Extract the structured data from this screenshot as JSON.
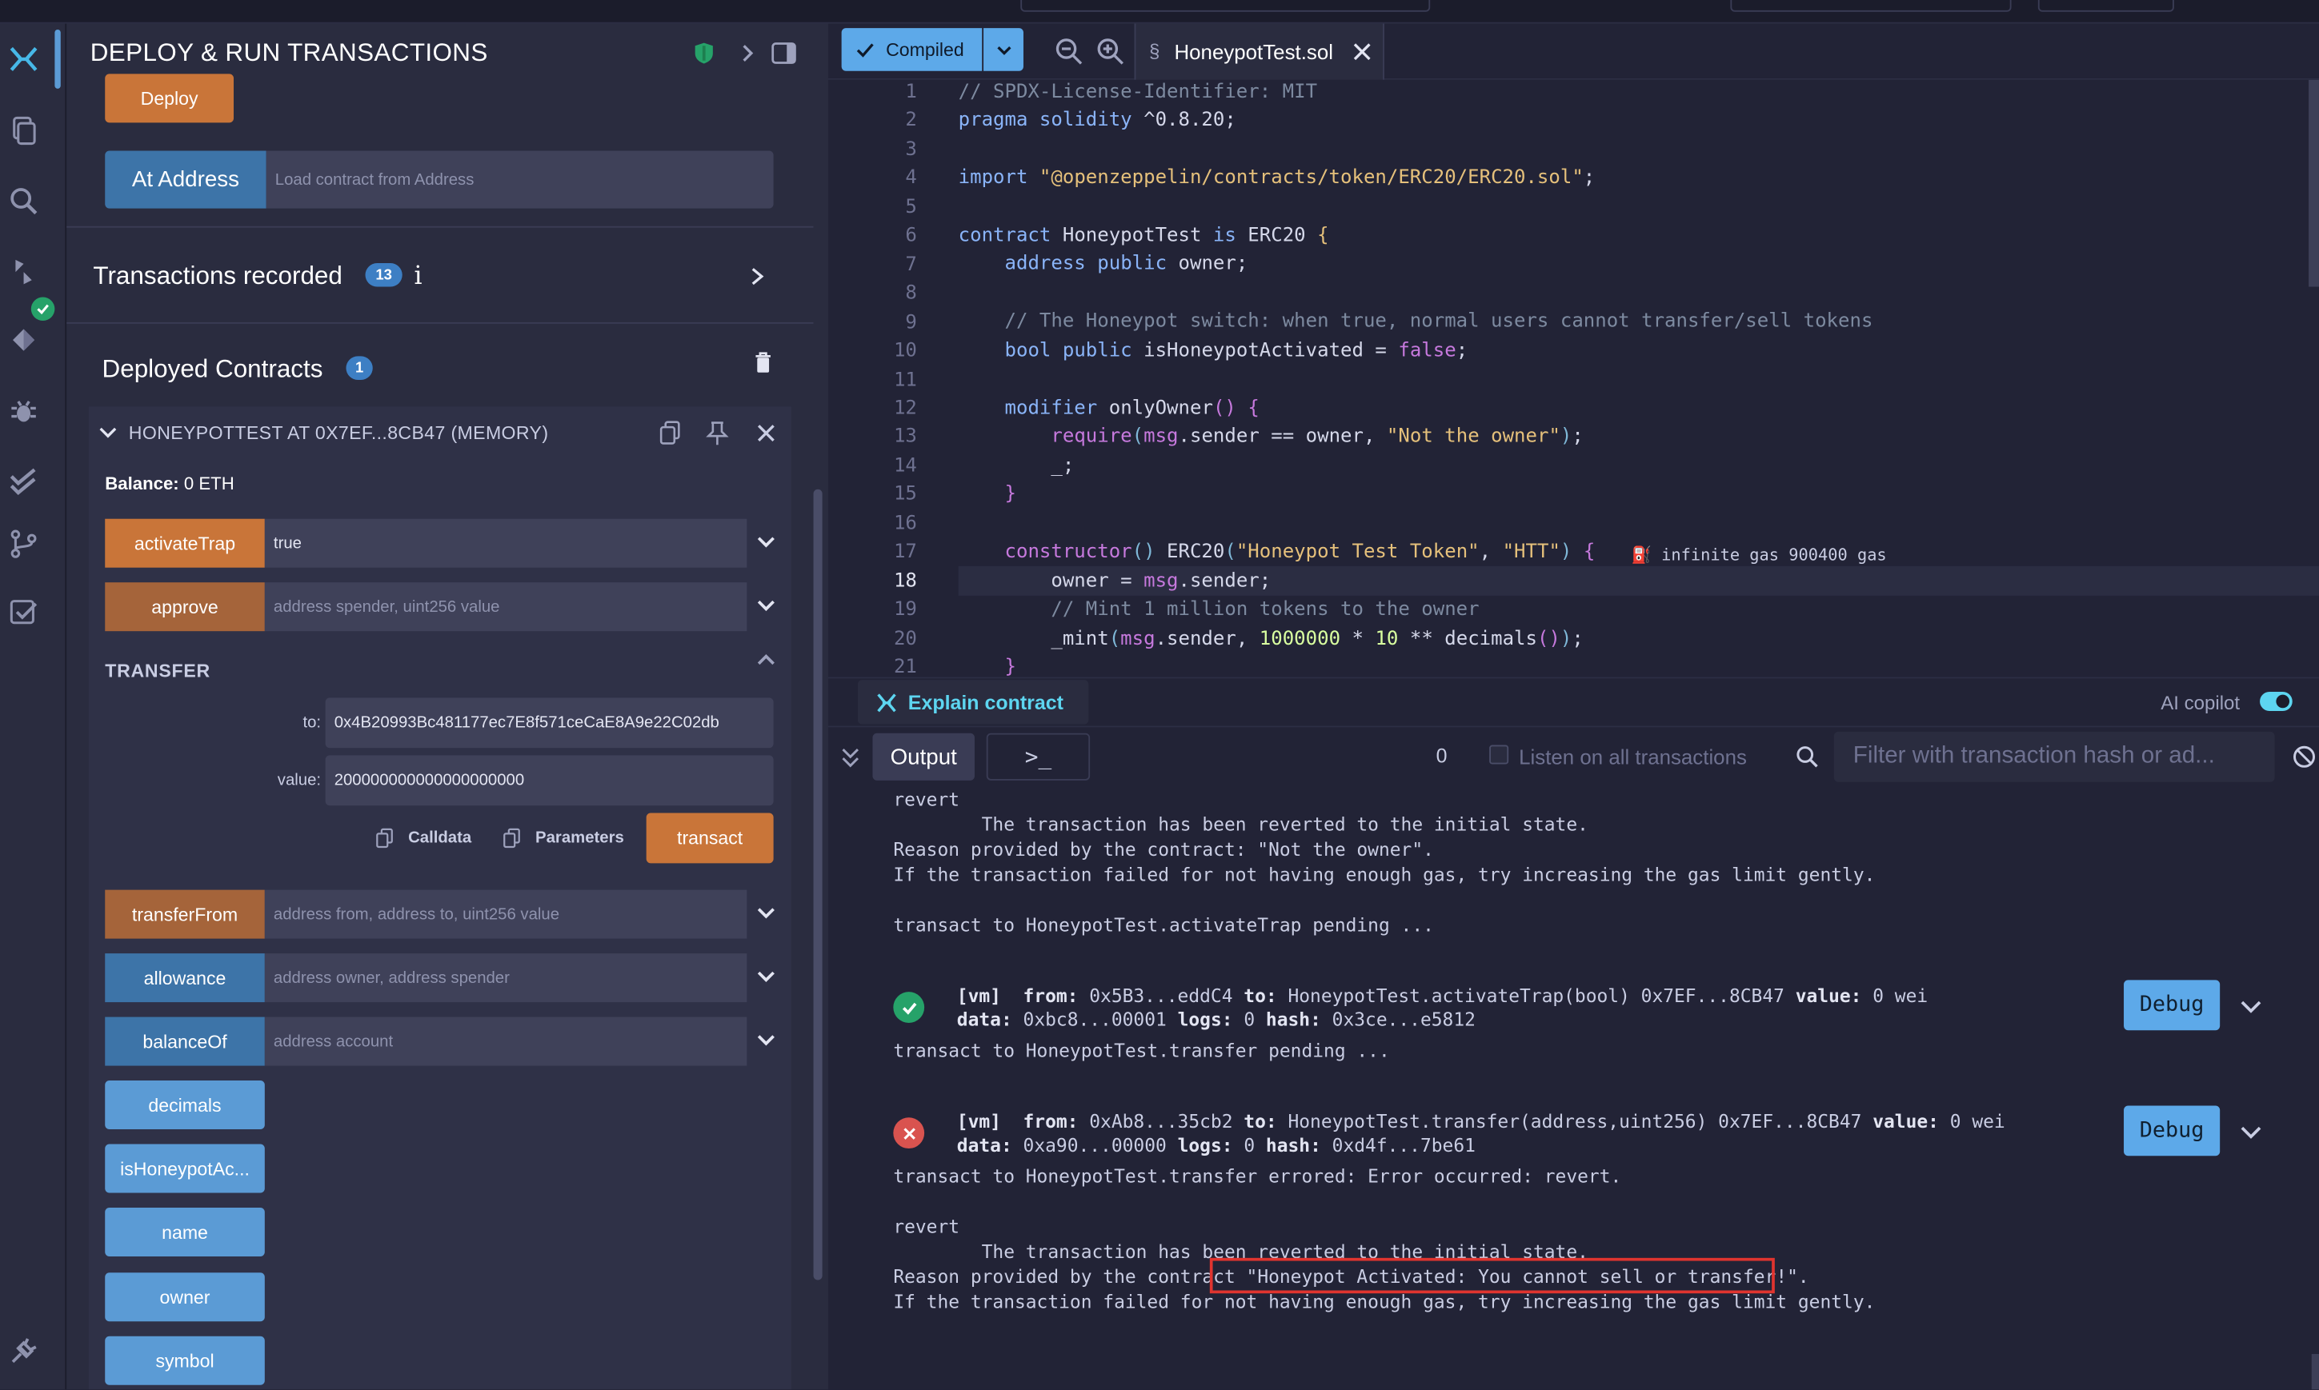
{
  "app": {
    "panel_title": "DEPLOY & RUN TRANSACTIONS",
    "deploy_label": "Deploy",
    "at_address_label": "At Address",
    "at_address_placeholder": "Load contract from Address",
    "tx_recorded_label": "Transactions recorded",
    "tx_recorded_count": "13",
    "tx_info_icon_label": "i",
    "deployed_label": "Deployed Contracts",
    "deployed_count": "1"
  },
  "contract": {
    "title": "HONEYPOTTEST AT 0X7EF...8CB47 (MEMORY)",
    "balance_label": "Balance:",
    "balance_value": "0 ETH",
    "functions": [
      {
        "label": "activateTrap",
        "value": "true",
        "placeholder": ""
      },
      {
        "label": "approve",
        "value": "",
        "placeholder": "address spender, uint256 value"
      },
      {
        "label": "transferFrom",
        "value": "",
        "placeholder": "address from, address to, uint256 value"
      },
      {
        "label": "allowance",
        "value": "",
        "placeholder": "address owner, address spender"
      },
      {
        "label": "balanceOf",
        "value": "",
        "placeholder": "address account"
      }
    ],
    "transfer": {
      "title": "TRANSFER",
      "to_label": "to:",
      "to_value": "0x4B20993Bc481177ec7E8f571ceCaE8A9e22C02db",
      "value_label": "value:",
      "value_value": "200000000000000000000",
      "calldata_label": "Calldata",
      "parameters_label": "Parameters",
      "transact_label": "transact"
    },
    "getters": [
      "decimals",
      "isHoneypotAc...",
      "name",
      "owner",
      "symbol"
    ]
  },
  "tabs": {
    "compiled_label": "Compiled",
    "file_tab": "HoneypotTest.sol"
  },
  "editor": {
    "line_numbers": [
      "1",
      "2",
      "3",
      "4",
      "5",
      "6",
      "7",
      "8",
      "9",
      "10",
      "11",
      "12",
      "13",
      "14",
      "15",
      "16",
      "17",
      "18",
      "19",
      "20",
      "21"
    ],
    "active_line": "18",
    "gas_hint": "infinite gas 900400 gas"
  },
  "ai": {
    "explain_label": "Explain contract",
    "copilot_label": "AI copilot"
  },
  "terminal": {
    "output_tab": "Output",
    "prompt_tab": ">_",
    "pending_count": "0",
    "listen_label": "Listen on all transactions",
    "filter_placeholder": "Filter with transaction hash or ad...",
    "lines": {
      "l1": "revert",
      "l2": "        The transaction has been reverted to the initial state.",
      "l3": "Reason provided by the contract: \"Not the owner\".",
      "l4": "If the transaction failed for not having enough gas, try increasing the gas limit gently.",
      "l5": "transact to HoneypotTest.activateTrap pending ...",
      "tx1_line1_a": "[vm]  from:",
      "tx1_line1_b": " 0x5B3...eddC4 ",
      "tx1_line1_c": "to:",
      "tx1_line1_d": " HoneypotTest.activateTrap(bool) 0x7EF...8CB47 ",
      "tx1_line1_e": "value:",
      "tx1_line1_f": " 0 wei",
      "tx1_line2_a": "data:",
      "tx1_line2_b": " 0xbc8...00001 ",
      "tx1_line2_c": "logs:",
      "tx1_line2_d": " 0 ",
      "tx1_line2_e": "hash:",
      "tx1_line2_f": " 0x3ce...e5812",
      "l6": "transact to HoneypotTest.transfer pending ...",
      "tx2_line1_a": "[vm]  from:",
      "tx2_line1_b": " 0xAb8...35cb2 ",
      "tx2_line1_c": "to:",
      "tx2_line1_d": " HoneypotTest.transfer(address,uint256) 0x7EF...8CB47 ",
      "tx2_line1_e": "value:",
      "tx2_line1_f": " 0 wei",
      "tx2_line2_a": "data:",
      "tx2_line2_b": " 0xa90...00000 ",
      "tx2_line2_c": "logs:",
      "tx2_line2_d": " 0 ",
      "tx2_line2_e": "hash:",
      "tx2_line2_f": " 0xd4f...7be61",
      "l7": "transact to HoneypotTest.transfer errored: Error occurred: revert.",
      "l8": "revert",
      "l9": "        The transaction has been reverted to the initial state.",
      "l10a": "Reason provided by the contract",
      "l10b": " \"Honeypot Activated: You cannot sell or transfer!\".",
      "l11": "If the transaction failed for not having enough gas, try increasing the gas limit gently.",
      "debug_label": "Debug"
    }
  },
  "colors": {
    "accent_blue": "#5b9bd5",
    "accent_orange": "#c97539",
    "success": "#26a269",
    "error": "#d9534f",
    "highlight_box": "#e0342f"
  }
}
